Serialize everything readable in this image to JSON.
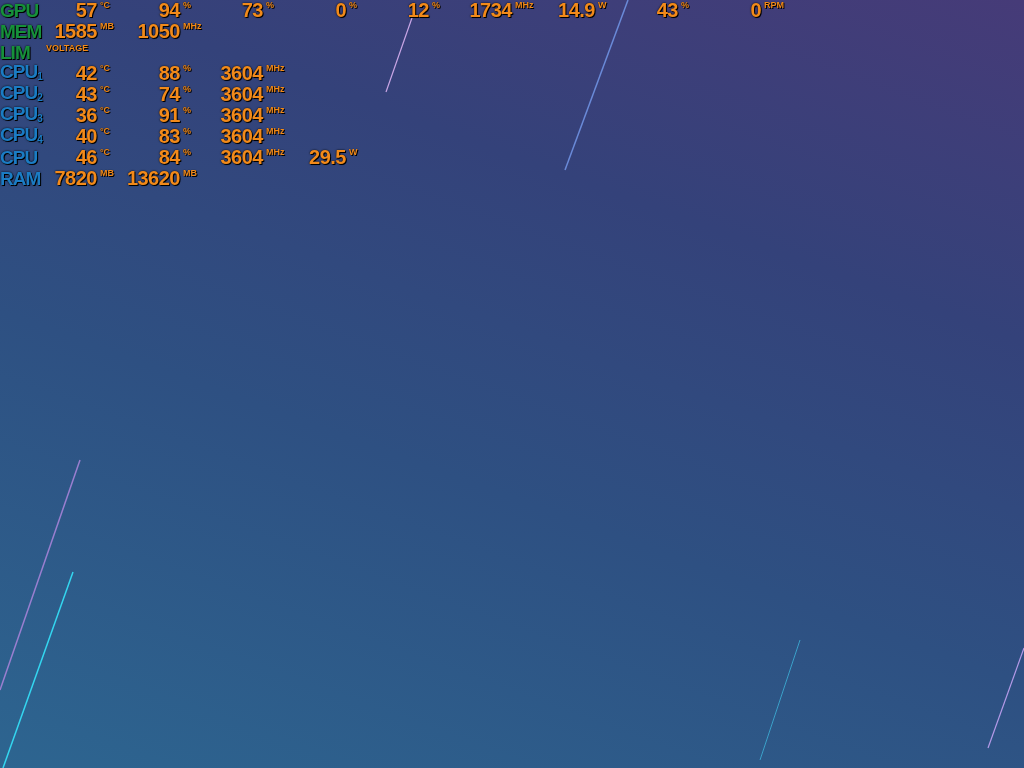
{
  "osd": {
    "rows": [
      {
        "kind": "gpu",
        "label": "GPU",
        "cells": [
          {
            "value": "57",
            "unit": "°C"
          },
          {
            "value": "94",
            "unit": "%"
          },
          {
            "value": "73",
            "unit": "%"
          },
          {
            "value": "0",
            "unit": "%"
          },
          {
            "value": "12",
            "unit": "%"
          },
          {
            "value": "1734",
            "unit": "MHz"
          },
          {
            "value": "14.9",
            "unit": "W"
          },
          {
            "value": "43",
            "unit": "%"
          },
          {
            "value": "0",
            "unit": "RPM"
          }
        ]
      },
      {
        "kind": "gpu",
        "label": "MEM",
        "cells": [
          {
            "value": "1585",
            "unit": "MB"
          },
          {
            "value": "1050",
            "unit": "MHz"
          }
        ]
      },
      {
        "kind": "gpu",
        "label": "LIM",
        "note": "VOLTAGE"
      },
      {
        "kind": "cpu",
        "label": "CPU$_{1}$",
        "cells": [
          {
            "value": "42",
            "unit": "°C"
          },
          {
            "value": "88",
            "unit": "%"
          },
          {
            "value": "3604",
            "unit": "MHz"
          }
        ]
      },
      {
        "kind": "cpu",
        "label": "CPU$_{2}$",
        "cells": [
          {
            "value": "43",
            "unit": "°C"
          },
          {
            "value": "74",
            "unit": "%"
          },
          {
            "value": "3604",
            "unit": "MHz"
          }
        ]
      },
      {
        "kind": "cpu",
        "label": "CPU$_{3}$",
        "cells": [
          {
            "value": "36",
            "unit": "°C"
          },
          {
            "value": "91",
            "unit": "%"
          },
          {
            "value": "3604",
            "unit": "MHz"
          }
        ]
      },
      {
        "kind": "cpu",
        "label": "CPU$_{4}$",
        "cells": [
          {
            "value": "40",
            "unit": "°C"
          },
          {
            "value": "83",
            "unit": "%"
          },
          {
            "value": "3604",
            "unit": "MHz"
          }
        ]
      },
      {
        "kind": "cpu",
        "label": "CPU",
        "cells": [
          {
            "value": "46",
            "unit": "°C"
          },
          {
            "value": "84",
            "unit": "%"
          },
          {
            "value": "3604",
            "unit": "MHz"
          },
          {
            "value": "29.5",
            "unit": "W"
          }
        ]
      },
      {
        "kind": "cpu",
        "label": "RAM",
        "cells": [
          {
            "value": "7820",
            "unit": "MB"
          },
          {
            "value": "13620",
            "unit": "MB"
          }
        ]
      }
    ]
  }
}
